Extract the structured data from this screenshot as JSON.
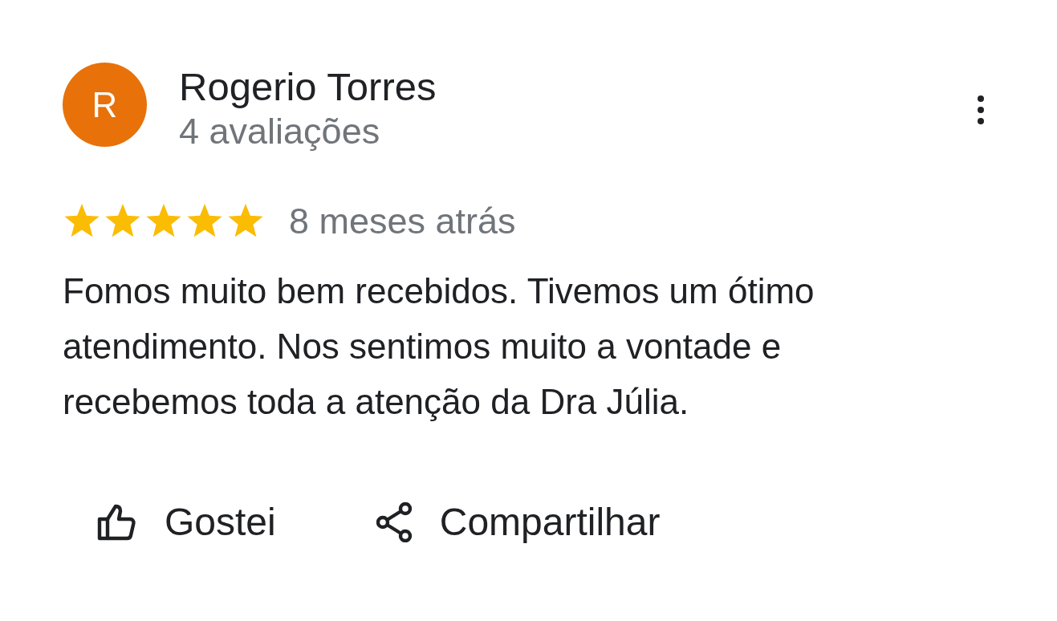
{
  "review": {
    "avatar_letter": "R",
    "author": "Rogerio Torres",
    "review_count": "4 avaliações",
    "stars": 5,
    "time": "8 meses atrás",
    "text": "Fomos muito bem recebidos. Tivemos um ótimo atendimento. Nos sentimos muito a vontade e recebemos toda a atenção da Dra Júlia.",
    "actions": [
      {
        "kind": "like",
        "label": "Gostei"
      },
      {
        "kind": "share",
        "label": "Compartilhar"
      }
    ]
  }
}
